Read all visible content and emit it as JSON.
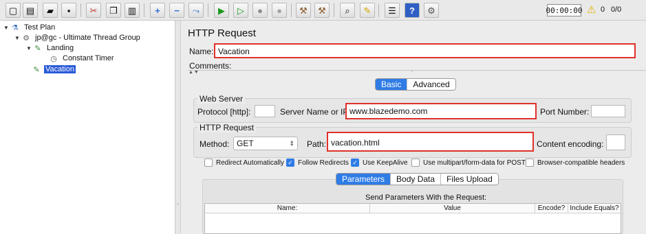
{
  "toolbar": {
    "buttons": [
      {
        "name": "new",
        "glyph": "▢"
      },
      {
        "name": "templates",
        "glyph": "▤"
      },
      {
        "name": "open",
        "glyph": "▰"
      },
      {
        "name": "save",
        "glyph": "▪"
      },
      {
        "name": "cut",
        "glyph": "✂"
      },
      {
        "name": "copy",
        "glyph": "❐"
      },
      {
        "name": "paste",
        "glyph": "▥"
      },
      {
        "name": "expand",
        "glyph": "+"
      },
      {
        "name": "collapse",
        "glyph": "−"
      },
      {
        "name": "toggle",
        "glyph": "⤳"
      },
      {
        "name": "start",
        "glyph": "▶"
      },
      {
        "name": "start-no-pauses",
        "glyph": "▷"
      },
      {
        "name": "stop",
        "glyph": "●"
      },
      {
        "name": "shutdown",
        "glyph": "●"
      },
      {
        "name": "clear",
        "glyph": "⚒"
      },
      {
        "name": "clear-all",
        "glyph": "⚒"
      },
      {
        "name": "search",
        "glyph": "⌕"
      },
      {
        "name": "reset-search",
        "glyph": "✎"
      },
      {
        "name": "function-helper",
        "glyph": "☰"
      },
      {
        "name": "help",
        "glyph": "?"
      },
      {
        "name": "remote",
        "glyph": "⚙"
      }
    ],
    "timer": "00:00:00",
    "warning_count": "0",
    "threads": "0/0"
  },
  "tree": {
    "items": [
      {
        "label": "Test Plan",
        "toggle": "▼",
        "icon": "flask-icon",
        "glyph": "⚗"
      },
      {
        "label": "jp@gc - Ultimate Thread Group",
        "toggle": "▼",
        "icon": "gear-icon",
        "glyph": "⚙"
      },
      {
        "label": "Landing",
        "toggle": "▼",
        "icon": "pipette-icon",
        "glyph": "✎"
      },
      {
        "label": "Constant Timer",
        "toggle": "",
        "icon": "clock-icon",
        "glyph": "◷"
      },
      {
        "label": "Vacation",
        "toggle": "",
        "icon": "pipette-icon",
        "glyph": "✎",
        "selected": true
      }
    ]
  },
  "main": {
    "title": "HTTP Request",
    "name_label": "Name:",
    "name_value": "Vacation",
    "comments_label": "Comments:",
    "tabs": [
      {
        "label": "Basic",
        "active": true
      },
      {
        "label": "Advanced",
        "active": false
      }
    ],
    "web_server": {
      "title": "Web Server",
      "protocol_label": "Protocol [http]:",
      "protocol_value": "",
      "server_label": "Server Name or IP:",
      "server_value": "www.blazedemo.com",
      "port_label": "Port Number:",
      "port_value": ""
    },
    "http_request": {
      "title": "HTTP Request",
      "method_label": "Method:",
      "method_value": "GET",
      "path_label": "Path:",
      "path_value": "vacation.html",
      "encoding_label": "Content encoding:",
      "encoding_value": ""
    },
    "checkboxes": [
      {
        "label": "Redirect Automatically",
        "checked": false
      },
      {
        "label": "Follow Redirects",
        "checked": true
      },
      {
        "label": "Use KeepAlive",
        "checked": true
      },
      {
        "label": "Use multipart/form-data for POST",
        "checked": false
      },
      {
        "label": "Browser-compatible headers",
        "checked": false
      }
    ],
    "sub_tabs": [
      {
        "label": "Parameters",
        "active": true
      },
      {
        "label": "Body Data",
        "active": false
      },
      {
        "label": "Files Upload",
        "active": false
      }
    ],
    "params_caption": "Send Parameters With the Request:",
    "columns": [
      "Name:",
      "Value",
      "Encode?",
      "Include Equals?"
    ]
  },
  "colors": {
    "accent": "#2f7ce6",
    "highlight": "#e0302a",
    "selection": "#2a5ad8"
  }
}
